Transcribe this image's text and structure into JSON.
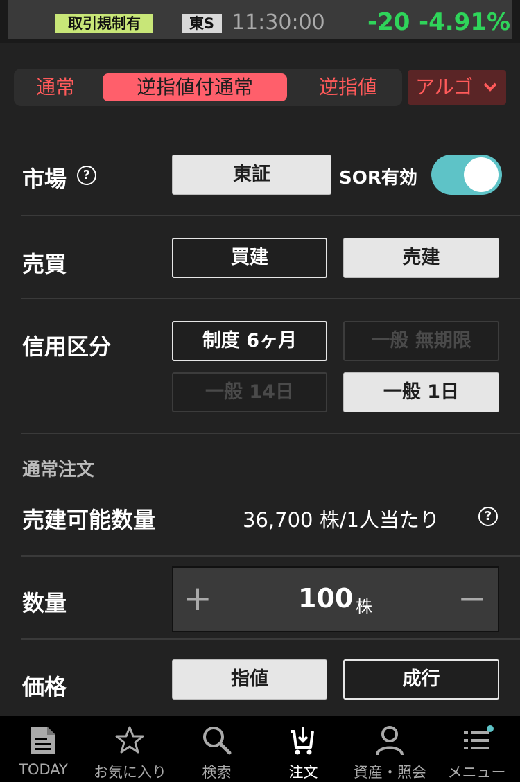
{
  "header": {
    "regulation_badge": "取引規制有",
    "market_badge": "東S",
    "time": "11:30:00",
    "change": "-20",
    "change_pct": "-4.91%"
  },
  "order_tabs": [
    "通常",
    "逆指値付通常",
    "逆指値"
  ],
  "algo_label": "アルゴ",
  "market": {
    "label": "市場",
    "value": "東証",
    "sor_label": "SOR有効",
    "sor_enabled": true
  },
  "trade": {
    "label": "売買",
    "buy": "買建",
    "sell": "売建"
  },
  "credit": {
    "label": "信用区分",
    "options": [
      "制度 6ヶ月",
      "一般 無期限",
      "一般 14日",
      "一般 1日"
    ]
  },
  "section_title": "通常注文",
  "available": {
    "label": "売建可能数量",
    "value": "36,700 株/1人当たり"
  },
  "quantity": {
    "label": "数量",
    "value": "100",
    "unit": "株"
  },
  "price": {
    "label": "価格",
    "limit": "指値",
    "market": "成行"
  },
  "bottom_nav": [
    "TODAY",
    "お気に入り",
    "検索",
    "注文",
    "資産・照会",
    "メニュー"
  ],
  "colors": {
    "accent_red": "#ff5f6b",
    "up_green": "#2fd45a",
    "toggle_on": "#5ec3c7"
  }
}
